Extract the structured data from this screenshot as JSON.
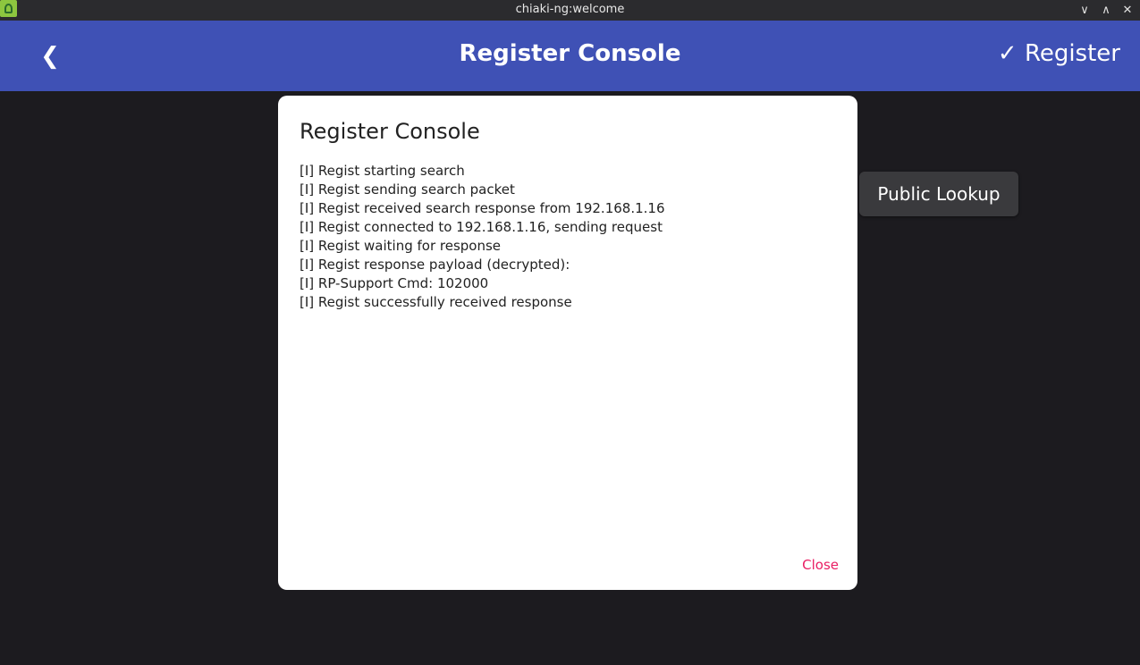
{
  "window": {
    "title": "chiaki-ng:welcome",
    "controls": [
      "∨",
      "∧",
      "✕"
    ]
  },
  "appbar": {
    "back_label": "❮",
    "title": "Register Console",
    "register_label": "✓ Register",
    "color": "#3f51b5"
  },
  "side_button": {
    "label": "Public Lookup"
  },
  "dialog": {
    "title": "Register Console",
    "log_lines": [
      "[I] Regist starting search",
      "[I] Regist sending search packet",
      "[I] Regist received search response from 192.168.1.16",
      "[I] Regist connected to 192.168.1.16, sending request",
      "[I] Regist waiting for response",
      "[I] Regist response payload (decrypted):",
      "[I] RP-Support Cmd: 102000",
      "[I] Regist successfully received response"
    ],
    "close_label": "Close",
    "close_color": "#e91e63"
  }
}
